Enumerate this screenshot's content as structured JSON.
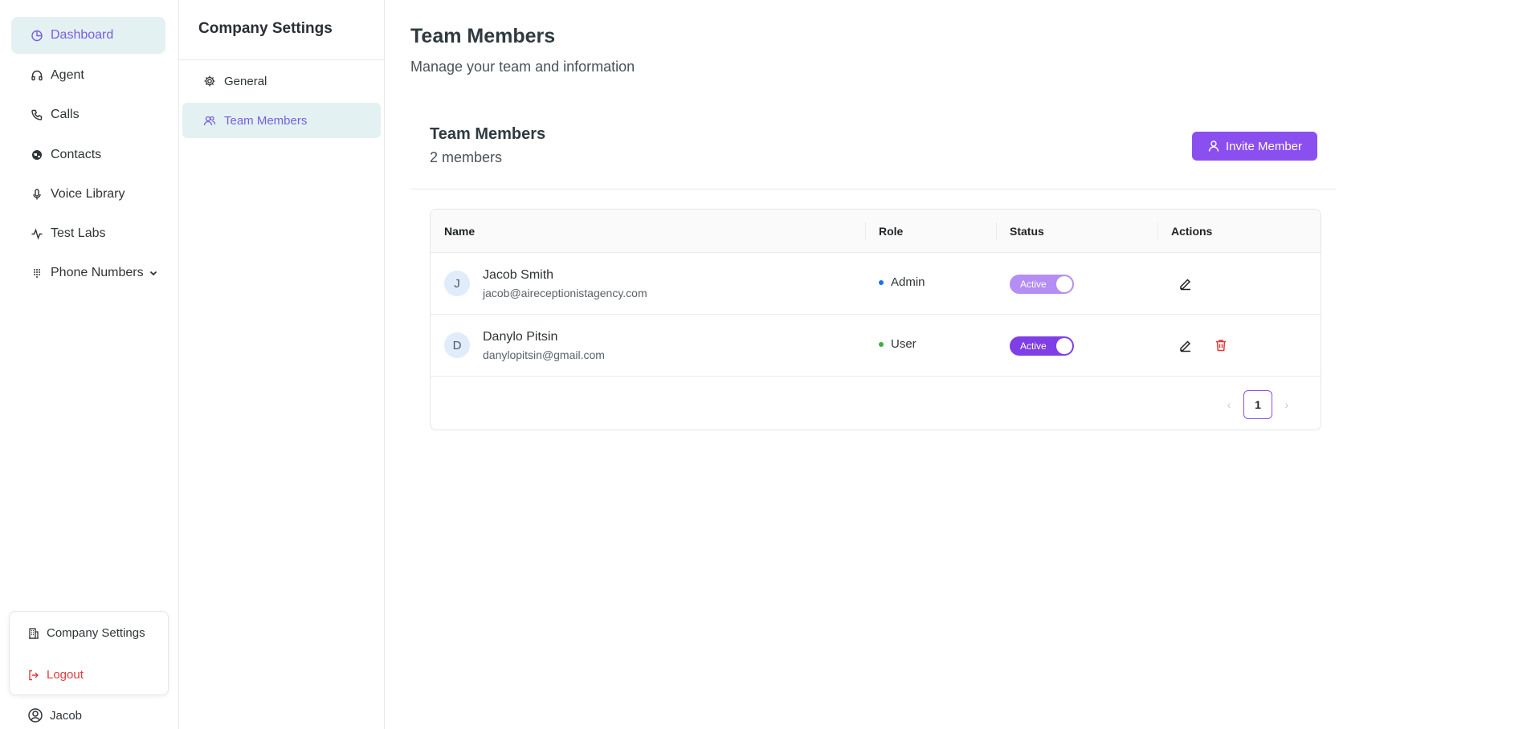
{
  "nav": {
    "items": [
      {
        "label": "Dashboard",
        "icon": "chart-pie-icon",
        "active": true
      },
      {
        "label": "Agent",
        "icon": "headphones-icon"
      },
      {
        "label": "Calls",
        "icon": "phone-icon"
      },
      {
        "label": "Contacts",
        "icon": "globe-icon"
      },
      {
        "label": "Voice Library",
        "icon": "microphone-icon"
      },
      {
        "label": "Test Labs",
        "icon": "activity-icon"
      },
      {
        "label": "Phone Numbers",
        "icon": "grid-icon"
      }
    ],
    "popup": {
      "company_settings": "Company Settings",
      "logout": "Logout"
    },
    "user": "Jacob"
  },
  "settings": {
    "title": "Company Settings",
    "items": [
      {
        "label": "General",
        "icon": "gear-icon"
      },
      {
        "label": "Team Members",
        "icon": "users-icon",
        "active": true
      }
    ]
  },
  "main": {
    "title": "Team Members",
    "subtitle": "Manage your team and information",
    "section": {
      "title": "Team Members",
      "count": "2 members",
      "invite_label": "Invite Member"
    },
    "table": {
      "columns": [
        "Name",
        "Role",
        "Status",
        "Actions"
      ],
      "rows": [
        {
          "initial": "J",
          "name": "Jacob Smith",
          "email": "jacob@aireceptionistagency.com",
          "role": "Admin",
          "role_color": "#1a73e8",
          "status": "Active"
        },
        {
          "initial": "D",
          "name": "Danylo Pitsin",
          "email": "danylopitsin@gmail.com",
          "role": "User",
          "role_color": "#3cb043",
          "status": "Active"
        }
      ]
    },
    "pagination": {
      "current": "1",
      "prev": "‹",
      "next": "›"
    }
  },
  "colors": {
    "accent": "#8b4ff0",
    "active_bg": "#e3f1f2",
    "danger": "#e03b3b"
  }
}
